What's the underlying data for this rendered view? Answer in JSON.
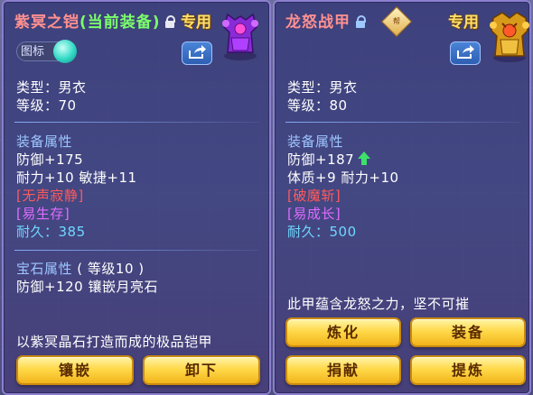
{
  "left": {
    "title": "紫冥之铠",
    "title_suffix": "(当前装备)",
    "special": "专用",
    "badge": "图标",
    "type_line": "类型：男衣",
    "level_line": "等级：70",
    "attr_header": "装备属性",
    "attr_lines": [
      "防御+175",
      "耐力+10 敏捷+11"
    ],
    "skill_red": "[无声寂静]",
    "skill_pink": "[易生存]",
    "durability_label": "耐久：",
    "durability_value": "385",
    "gem_header": "宝石属性",
    "gem_level": "( 等级10 )",
    "gem_line": "防御+120 镶嵌月亮石",
    "desc": "以紫冥晶石打造而成的极品铠甲",
    "buttons": [
      "镶嵌",
      "卸下"
    ]
  },
  "right": {
    "title": "龙怒战甲",
    "special": "专用",
    "seal": "帮",
    "type_line": "类型：男衣",
    "level_line": "等级：80",
    "attr_header": "装备属性",
    "attr_lines": [
      "防御+187",
      "体质+9 耐力+10"
    ],
    "skill_red": "[破魔斩]",
    "skill_pink": "[易成长]",
    "durability_label": "耐久：",
    "durability_value": "500",
    "desc": "此甲蕴含龙怒之力，坚不可摧",
    "buttons": [
      "炼化",
      "装备",
      "捐献",
      "提炼"
    ]
  },
  "colors": {
    "title": "#ff9090",
    "current_tag": "#7bff6a",
    "special": "#ffe06a",
    "label": "#9ec6ff",
    "red_skill": "#ff5a5a",
    "pink_skill": "#e06bff",
    "durability": "#6fd7ff",
    "button": "#ffd94a",
    "up_arrow": "#3de06a"
  },
  "icons": {
    "left_item": "purple-armor-icon",
    "right_item": "golden-dragon-armor-icon",
    "share": "share-icon",
    "lock": "lock-icon",
    "up_arrow": "up-arrow-icon",
    "seal": "gang-seal-icon"
  }
}
